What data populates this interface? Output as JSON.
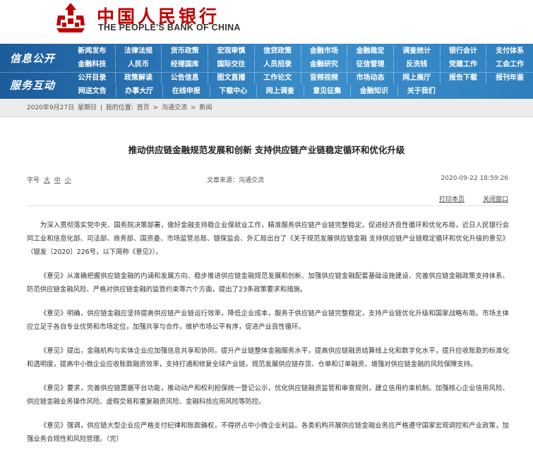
{
  "header": {
    "logo_cn": "中国人民银行",
    "logo_en": "THE PEOPLE'S BANK OF CHINA",
    "brand_color": "#c00000"
  },
  "nav": {
    "info_label": "信息公开",
    "service_label": "服务互动",
    "row1": [
      "新闻发布",
      "法律法规",
      "货币政策",
      "宏观审慎",
      "信贷政策",
      "金融市场",
      "金融稳定",
      "调查统计",
      "银行会计",
      "支付体系"
    ],
    "row2": [
      "金融科技",
      "人民币",
      "经理国库",
      "国际交往",
      "人员招录",
      "金融研究",
      "征信管理",
      "反洗钱",
      "党建工作",
      "工会工作"
    ],
    "row3": [
      "公开目录",
      "政策解读",
      "公告信息",
      "图文直播",
      "工作论文",
      "音频视频",
      "市场动态",
      "网上展厅",
      "报告下载",
      "报刊年鉴"
    ],
    "row4": [
      "网送文告",
      "办事大厅",
      "在线申报",
      "下载中心",
      "网上调查",
      "意见征集",
      "金融知识",
      "关于我们"
    ]
  },
  "breadcrumb": {
    "date": "2020年9月27日",
    "weekday": "星期日",
    "location_label": "我的位置:",
    "home": "首页",
    "section": "沟通交流",
    "subsection": "新闻",
    "sep": ">"
  },
  "article": {
    "title": "推动供应链金融规范发展和创新  支持供应链产业链稳定循环和优化升级",
    "font_label": "字号",
    "font_large": "大",
    "font_medium": "中",
    "font_small": "小",
    "source": "文章来源：沟通交流",
    "date": "2020-09-22 18:59:26",
    "print": "打印本页",
    "close": "关闭窗口",
    "paragraphs": [
      "为深入贯彻落实党中央、国务院决策部署，做好金融支持稳企业保就业工作，精准服务供应链产业链完整稳定，促进经济良性循环和优化布局，近日人民银行会同工业和信息化部、司法部、商务部、国资委、市场监管总局、银保监会、外汇局出台了《关于规范发展供应链金融 支持供应链产业链稳定循环和优化升级的意见》（银发〔2020〕226号，以下简称《意见》）。",
      "《意见》从准确把握供应链金融的内涵和发展方向、稳步推进供应链金融规范发展和创新、加强供应链金融配套基础设施建设、完善供应链金融政策支持体系、防范供应链金融风险、严格对供应链金融的监管约束等六个方面，提出了23条政策要求和措施。",
      "《意见》明确，供应链金融应坚持提高供应链产业链运行效率，降低企业成本，服务于供应链产业链完整稳定，支持产业链优化升级和国家战略布局。市场主体应立足于各自专业优势和市场定位，加强共享与合作，维护市场公平有序，促进产业良性循环。",
      "《意见》提出，金融机构与实体企业应加强信息共享和协同，提升产业链整体金融服务水平，提高供应链融资结算线上化和数字化水平，提升应收账款的标准化和透明度，提高中小微企业应收账款融资效率，支持打通和修复全球产业链，规范发展供应链存货、仓单和订单融资，增强对供应链金融的风险保障支持。",
      "《意见》要求，完善供应链票据平台功能，推动动产和权利担保统一登记公示，优化供应链融资监管和审查规则，建立信用约束机制。加强核心企业信用风险、供应链金融业务操作风险、虚假交易和重复融资风险、金融科技应用风险等防控。",
      "《意见》强调，供应链大型企业应严格支付纪律和账款确权，不得挤占中小微企业利益。各类机构开展供应链金融业务应严格遵守国家宏观调控和产业政策，加强业务合规性和风险管理。（完）"
    ]
  }
}
